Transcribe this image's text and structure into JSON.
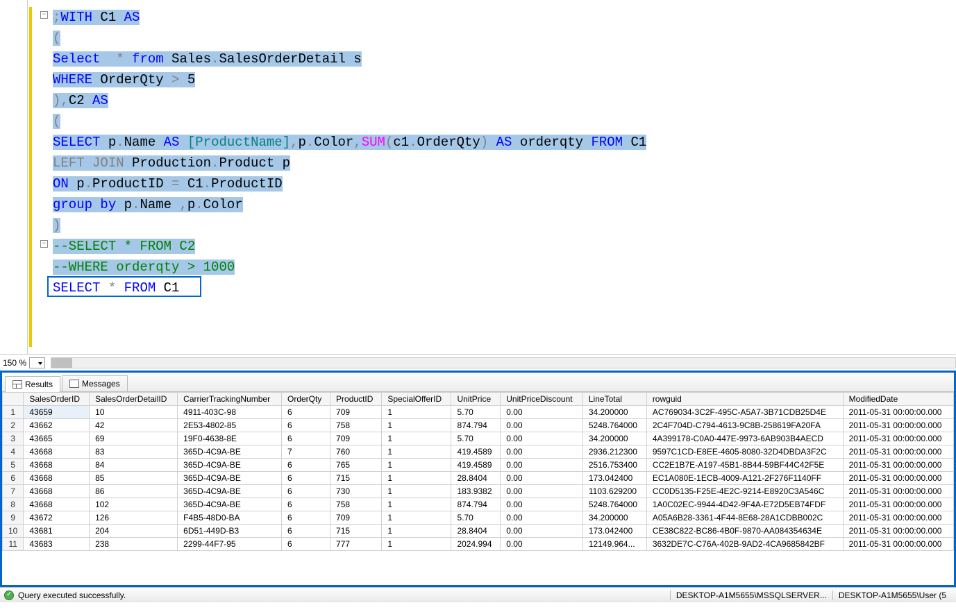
{
  "editor": {
    "zoom": "150 %",
    "lines": [
      {
        "indent": 0,
        "sel": true,
        "tokens": [
          {
            "t": ";",
            "c": "kw-gray"
          },
          {
            "t": "WITH",
            "c": "kw-blue"
          },
          {
            "t": " C1 ",
            "c": "txt"
          },
          {
            "t": "AS",
            "c": "kw-blue"
          }
        ]
      },
      {
        "indent": 0,
        "sel": true,
        "tokens": [
          {
            "t": "(",
            "c": "kw-gray"
          }
        ]
      },
      {
        "indent": 0,
        "sel": true,
        "tokens": [
          {
            "t": "Select",
            "c": "kw-blue"
          },
          {
            "t": "  ",
            "c": "txt"
          },
          {
            "t": "*",
            "c": "kw-gray"
          },
          {
            "t": " ",
            "c": "txt"
          },
          {
            "t": "from",
            "c": "kw-blue"
          },
          {
            "t": " Sales",
            "c": "txt"
          },
          {
            "t": ".",
            "c": "kw-gray"
          },
          {
            "t": "SalesOrderDetail s",
            "c": "txt"
          }
        ]
      },
      {
        "indent": 0,
        "sel": true,
        "tokens": [
          {
            "t": "WHERE",
            "c": "kw-blue"
          },
          {
            "t": " OrderQty ",
            "c": "txt"
          },
          {
            "t": ">",
            "c": "kw-gray"
          },
          {
            "t": " 5",
            "c": "txt"
          }
        ]
      },
      {
        "indent": 0,
        "sel": true,
        "tokens": [
          {
            "t": "),",
            "c": "kw-gray"
          },
          {
            "t": "C2 ",
            "c": "txt"
          },
          {
            "t": "AS",
            "c": "kw-blue"
          }
        ]
      },
      {
        "indent": 0,
        "sel": true,
        "tokens": [
          {
            "t": "(",
            "c": "kw-gray"
          }
        ]
      },
      {
        "indent": 0,
        "sel": true,
        "tokens": [
          {
            "t": "SELECT",
            "c": "kw-blue"
          },
          {
            "t": " p",
            "c": "txt"
          },
          {
            "t": ".",
            "c": "kw-gray"
          },
          {
            "t": "Name ",
            "c": "txt"
          },
          {
            "t": "AS",
            "c": "kw-blue"
          },
          {
            "t": " ",
            "c": "txt"
          },
          {
            "t": "[ProductName]",
            "c": "kw-teal"
          },
          {
            "t": ",",
            "c": "kw-gray"
          },
          {
            "t": "p",
            "c": "txt"
          },
          {
            "t": ".",
            "c": "kw-gray"
          },
          {
            "t": "Color",
            "c": "txt"
          },
          {
            "t": ",",
            "c": "kw-gray"
          },
          {
            "t": "SUM",
            "c": "kw-pink"
          },
          {
            "t": "(",
            "c": "kw-gray"
          },
          {
            "t": "c1",
            "c": "txt"
          },
          {
            "t": ".",
            "c": "kw-gray"
          },
          {
            "t": "OrderQty",
            "c": "txt"
          },
          {
            "t": ")",
            "c": "kw-gray"
          },
          {
            "t": " ",
            "c": "txt"
          },
          {
            "t": "AS",
            "c": "kw-blue"
          },
          {
            "t": " orderqty ",
            "c": "txt"
          },
          {
            "t": "FROM",
            "c": "kw-blue"
          },
          {
            "t": " C1",
            "c": "txt"
          }
        ]
      },
      {
        "indent": 0,
        "sel": true,
        "tokens": [
          {
            "t": "LEFT JOIN",
            "c": "kw-gray"
          },
          {
            "t": " Production",
            "c": "txt"
          },
          {
            "t": ".",
            "c": "kw-gray"
          },
          {
            "t": "Product p",
            "c": "txt"
          }
        ]
      },
      {
        "indent": 0,
        "sel": true,
        "tokens": [
          {
            "t": "ON",
            "c": "kw-blue"
          },
          {
            "t": " p",
            "c": "txt"
          },
          {
            "t": ".",
            "c": "kw-gray"
          },
          {
            "t": "ProductID ",
            "c": "txt"
          },
          {
            "t": "=",
            "c": "kw-gray"
          },
          {
            "t": " C1",
            "c": "txt"
          },
          {
            "t": ".",
            "c": "kw-gray"
          },
          {
            "t": "ProductID",
            "c": "txt"
          }
        ]
      },
      {
        "indent": 0,
        "sel": true,
        "tokens": [
          {
            "t": "group by",
            "c": "kw-blue"
          },
          {
            "t": " p",
            "c": "txt"
          },
          {
            "t": ".",
            "c": "kw-gray"
          },
          {
            "t": "Name ",
            "c": "txt"
          },
          {
            "t": ",",
            "c": "kw-gray"
          },
          {
            "t": "p",
            "c": "txt"
          },
          {
            "t": ".",
            "c": "kw-gray"
          },
          {
            "t": "Color",
            "c": "txt"
          }
        ]
      },
      {
        "indent": 0,
        "sel": true,
        "tokens": [
          {
            "t": ")",
            "c": "kw-gray"
          }
        ]
      },
      {
        "indent": 0,
        "sel": true,
        "tokens": [
          {
            "t": "--SELECT * FROM C2",
            "c": "kw-green"
          }
        ]
      },
      {
        "indent": 0,
        "sel": true,
        "tokens": [
          {
            "t": "--WHERE orderqty > 1000",
            "c": "kw-green"
          }
        ]
      },
      {
        "indent": 0,
        "sel": false,
        "tokens": [
          {
            "t": "SELECT",
            "c": "kw-blue"
          },
          {
            "t": " ",
            "c": "txt"
          },
          {
            "t": "*",
            "c": "kw-gray"
          },
          {
            "t": " ",
            "c": "txt"
          },
          {
            "t": "FROM",
            "c": "kw-blue"
          },
          {
            "t": " C1",
            "c": "txt"
          }
        ]
      }
    ]
  },
  "tabs": {
    "results": "Results",
    "messages": "Messages"
  },
  "table": {
    "headers": [
      "SalesOrderID",
      "SalesOrderDetailID",
      "CarrierTrackingNumber",
      "OrderQty",
      "ProductID",
      "SpecialOfferID",
      "UnitPrice",
      "UnitPriceDiscount",
      "LineTotal",
      "rowguid",
      "ModifiedDate"
    ],
    "rows": [
      [
        "43659",
        "10",
        "4911-403C-98",
        "6",
        "709",
        "1",
        "5.70",
        "0.00",
        "34.200000",
        "AC769034-3C2F-495C-A5A7-3B71CDB25D4E",
        "2011-05-31 00:00:00.000"
      ],
      [
        "43662",
        "42",
        "2E53-4802-85",
        "6",
        "758",
        "1",
        "874.794",
        "0.00",
        "5248.764000",
        "2C4F704D-C794-4613-9C8B-258619FA20FA",
        "2011-05-31 00:00:00.000"
      ],
      [
        "43665",
        "69",
        "19F0-4638-8E",
        "6",
        "709",
        "1",
        "5.70",
        "0.00",
        "34.200000",
        "4A399178-C0A0-447E-9973-6AB903B4AECD",
        "2011-05-31 00:00:00.000"
      ],
      [
        "43668",
        "83",
        "365D-4C9A-BE",
        "7",
        "760",
        "1",
        "419.4589",
        "0.00",
        "2936.212300",
        "9597C1CD-E8EE-4605-8080-32D4DBDA3F2C",
        "2011-05-31 00:00:00.000"
      ],
      [
        "43668",
        "84",
        "365D-4C9A-BE",
        "6",
        "765",
        "1",
        "419.4589",
        "0.00",
        "2516.753400",
        "CC2E1B7E-A197-45B1-8B44-59BF44C42F5E",
        "2011-05-31 00:00:00.000"
      ],
      [
        "43668",
        "85",
        "365D-4C9A-BE",
        "6",
        "715",
        "1",
        "28.8404",
        "0.00",
        "173.042400",
        "EC1A080E-1ECB-4009-A121-2F276F1140FF",
        "2011-05-31 00:00:00.000"
      ],
      [
        "43668",
        "86",
        "365D-4C9A-BE",
        "6",
        "730",
        "1",
        "183.9382",
        "0.00",
        "1103.629200",
        "CC0D5135-F25E-4E2C-9214-E8920C3A546C",
        "2011-05-31 00:00:00.000"
      ],
      [
        "43668",
        "102",
        "365D-4C9A-BE",
        "6",
        "758",
        "1",
        "874.794",
        "0.00",
        "5248.764000",
        "1A0C02EC-9944-4D42-9F4A-E72D5EB74FDF",
        "2011-05-31 00:00:00.000"
      ],
      [
        "43672",
        "126",
        "F4B5-48D0-BA",
        "6",
        "709",
        "1",
        "5.70",
        "0.00",
        "34.200000",
        "A05A6B28-3361-4F44-8E68-28A1CDBB002C",
        "2011-05-31 00:00:00.000"
      ],
      [
        "43681",
        "204",
        "6D51-449D-B3",
        "6",
        "715",
        "1",
        "28.8404",
        "0.00",
        "173.042400",
        "CE38C822-BC86-4B0F-9870-AA084354634E",
        "2011-05-31 00:00:00.000"
      ],
      [
        "43683",
        "238",
        "2299-44F7-95",
        "6",
        "777",
        "1",
        "2024.994",
        "0.00",
        "12149.964...",
        "3632DE7C-C76A-402B-9AD2-4CA9685842BF",
        "2011-05-31 00:00:00.000"
      ]
    ]
  },
  "status": {
    "message": "Query executed successfully.",
    "server": "DESKTOP-A1M5655\\MSSQLSERVER...",
    "user": "DESKTOP-A1M5655\\User (5"
  }
}
